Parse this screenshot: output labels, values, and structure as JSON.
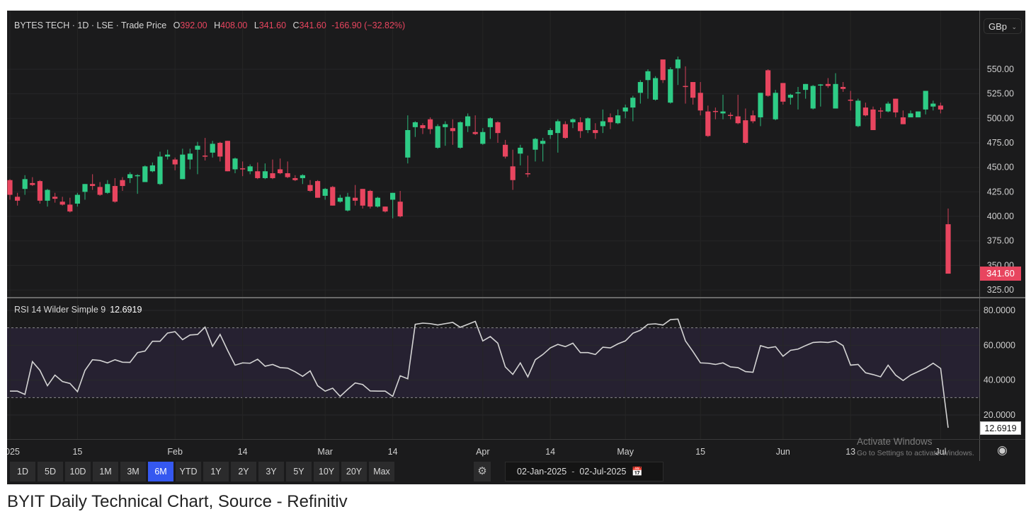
{
  "header": {
    "symbol": "BYTES TECH",
    "interval": "1D",
    "exchange": "LSE",
    "price_type": "Trade Price",
    "open_label": "O",
    "open": "392.00",
    "high_label": "H",
    "high": "408.00",
    "low_label": "L",
    "low": "341.60",
    "close_label": "C",
    "close": "341.60",
    "change": "-166.90",
    "change_pct": "(−32.82%)"
  },
  "currency": "GBp",
  "last_price_label": "341.60",
  "rsi": {
    "label": "RSI 14 Wilder Simple 9",
    "value": "12.6919"
  },
  "toolbar": {
    "ranges": [
      "1D",
      "5D",
      "10D",
      "1M",
      "3M",
      "6M",
      "YTD",
      "1Y",
      "2Y",
      "3Y",
      "5Y",
      "10Y",
      "20Y",
      "Max"
    ],
    "active": "6M",
    "date_from": "02-Jan-2025",
    "date_to": "02-Jul-2025",
    "sep": "-"
  },
  "watermark": {
    "line1": "Activate Windows",
    "line2": "Go to Settings to activate Windows."
  },
  "caption": "BYIT Daily Technical Chart, Source - Refinitiv",
  "colors": {
    "up": "#2ecc86",
    "down": "#e8455f",
    "background": "#1b1b1c",
    "rsi_line": "#d4d4d4",
    "rsi_band": "#262131"
  },
  "chart_data": [
    {
      "type": "candlestick",
      "title": "BYTES TECH · 1D · LSE · Trade Price",
      "ylabel": "GBp",
      "ylim": [
        318,
        570
      ],
      "yticks": [
        "550.00",
        "525.00",
        "500.00",
        "475.00",
        "450.00",
        "425.00",
        "400.00",
        "375.00",
        "350.00",
        "325.00"
      ],
      "ytick_values": [
        550,
        525,
        500,
        475,
        450,
        425,
        400,
        375,
        350,
        325
      ],
      "xticks": [
        {
          "label": "2025",
          "index": 0
        },
        {
          "label": "15",
          "index": 9
        },
        {
          "label": "Feb",
          "index": 22
        },
        {
          "label": "14",
          "index": 31
        },
        {
          "label": "Mar",
          "index": 42
        },
        {
          "label": "14",
          "index": 51
        },
        {
          "label": "Apr",
          "index": 63
        },
        {
          "label": "14",
          "index": 72
        },
        {
          "label": "May",
          "index": 82
        },
        {
          "label": "15",
          "index": 92
        },
        {
          "label": "Jun",
          "index": 103
        },
        {
          "label": "13",
          "index": 112
        },
        {
          "label": "Jul",
          "index": 124
        }
      ],
      "ohlc": [
        [
          437,
          438,
          417,
          422
        ],
        [
          420,
          424,
          411,
          416
        ],
        [
          428,
          442,
          422,
          438
        ],
        [
          434,
          440,
          431,
          432
        ],
        [
          436,
          437,
          413,
          416
        ],
        [
          416,
          428,
          410,
          427
        ],
        [
          420,
          424,
          414,
          418
        ],
        [
          415,
          420,
          411,
          412
        ],
        [
          412,
          419,
          404,
          405
        ],
        [
          413,
          424,
          410,
          422
        ],
        [
          425,
          433,
          417,
          433
        ],
        [
          433,
          443,
          427,
          431
        ],
        [
          430,
          435,
          421,
          422
        ],
        [
          424,
          437,
          423,
          433
        ],
        [
          431,
          439,
          414,
          415
        ],
        [
          437,
          440,
          426,
          431
        ],
        [
          439,
          445,
          434,
          443
        ],
        [
          442,
          443,
          423,
          442
        ],
        [
          435,
          452,
          435,
          451
        ],
        [
          446,
          455,
          445,
          452
        ],
        [
          433,
          466,
          432,
          461
        ],
        [
          461,
          468,
          458,
          463
        ],
        [
          458,
          460,
          447,
          453
        ],
        [
          438,
          469,
          438,
          463
        ],
        [
          458,
          469,
          448,
          464
        ],
        [
          468,
          476,
          443,
          472
        ],
        [
          462,
          480,
          457,
          461
        ],
        [
          465,
          477,
          460,
          474
        ],
        [
          475,
          476,
          456,
          461
        ],
        [
          477,
          477,
          446,
          446
        ],
        [
          448,
          460,
          444,
          459
        ],
        [
          449,
          456,
          441,
          448
        ],
        [
          446,
          453,
          443,
          451
        ],
        [
          446,
          455,
          438,
          439
        ],
        [
          439,
          454,
          438,
          446
        ],
        [
          444,
          458,
          438,
          439
        ],
        [
          448,
          459,
          443,
          444
        ],
        [
          444,
          456,
          439,
          440
        ],
        [
          439,
          442,
          436,
          437
        ],
        [
          439,
          443,
          433,
          442
        ],
        [
          432,
          437,
          425,
          426
        ],
        [
          436,
          437,
          419,
          419
        ],
        [
          421,
          429,
          417,
          428
        ],
        [
          430,
          431,
          411,
          411
        ],
        [
          415,
          422,
          414,
          419
        ],
        [
          406,
          424,
          405,
          420
        ],
        [
          419,
          432,
          411,
          416
        ],
        [
          428,
          428,
          408,
          411
        ],
        [
          426,
          427,
          408,
          410
        ],
        [
          410,
          420,
          409,
          419
        ],
        [
          410,
          410,
          404,
          405
        ],
        [
          417,
          424,
          398,
          424
        ],
        [
          415,
          426,
          399,
          400
        ],
        [
          460,
          503,
          454,
          488
        ],
        [
          491,
          497,
          481,
          496
        ],
        [
          493,
          495,
          484,
          490
        ],
        [
          499,
          501,
          484,
          489
        ],
        [
          470,
          494,
          469,
          492
        ],
        [
          491,
          497,
          472,
          494
        ],
        [
          490,
          499,
          473,
          487
        ],
        [
          470,
          497,
          469,
          496
        ],
        [
          492,
          505,
          486,
          502
        ],
        [
          486,
          503,
          483,
          484
        ],
        [
          474,
          490,
          473,
          486
        ],
        [
          491,
          501,
          479,
          500
        ],
        [
          496,
          497,
          475,
          485
        ],
        [
          473,
          478,
          459,
          461
        ],
        [
          451,
          468,
          427,
          437
        ],
        [
          464,
          473,
          452,
          470
        ],
        [
          444,
          462,
          440,
          443.5
        ],
        [
          468,
          480,
          456,
          479
        ],
        [
          474,
          480,
          456,
          477
        ],
        [
          483,
          490,
          479,
          488
        ],
        [
          485,
          499,
          465,
          497
        ],
        [
          494,
          497,
          479,
          480
        ],
        [
          496,
          500,
          490,
          499
        ],
        [
          496,
          501,
          480,
          487
        ],
        [
          488,
          501,
          485,
          500
        ],
        [
          488,
          495,
          479,
          485
        ],
        [
          492,
          509,
          485,
          497
        ],
        [
          501,
          505,
          489,
          496
        ],
        [
          495,
          509,
          494,
          503
        ],
        [
          507,
          514,
          500,
          511
        ],
        [
          511,
          523,
          497,
          521
        ],
        [
          526,
          539,
          515,
          537
        ],
        [
          539,
          550,
          520,
          548
        ],
        [
          519,
          543,
          518,
          541
        ],
        [
          560,
          560,
          536,
          539
        ],
        [
          516,
          552,
          515,
          550
        ],
        [
          551,
          563,
          534,
          560
        ],
        [
          533,
          553,
          515,
          532
        ],
        [
          537,
          537,
          514,
          521
        ],
        [
          526,
          537,
          503,
          508
        ],
        [
          507,
          513,
          481,
          482
        ],
        [
          507.5,
          511,
          499,
          507
        ],
        [
          505,
          524,
          499,
          507
        ],
        [
          503.5,
          506,
          499,
          503
        ],
        [
          502,
          524,
          494,
          495
        ],
        [
          498,
          510,
          474,
          475
        ],
        [
          503,
          508,
          495,
          497
        ],
        [
          501,
          526,
          492,
          526
        ],
        [
          549,
          550,
          522,
          523
        ],
        [
          499,
          529,
          498,
          526
        ],
        [
          536,
          536,
          514,
          517
        ],
        [
          521,
          525,
          514,
          524
        ],
        [
          526,
          532,
          509,
          526.5
        ],
        [
          529,
          535,
          520,
          535
        ],
        [
          510,
          534,
          509,
          533
        ],
        [
          534,
          535,
          512,
          534.5
        ],
        [
          535,
          541,
          531,
          533
        ],
        [
          510,
          546,
          510,
          535
        ],
        [
          532,
          537,
          527,
          530
        ],
        [
          519,
          528,
          508,
          518
        ],
        [
          492,
          520,
          491,
          518
        ],
        [
          511,
          516,
          502,
          503
        ],
        [
          509,
          512,
          488,
          488
        ],
        [
          508,
          511,
          500,
          507
        ],
        [
          507,
          517,
          506,
          515
        ],
        [
          520,
          520,
          501,
          506
        ],
        [
          501,
          508,
          494,
          494
        ],
        [
          501,
          508,
          501,
          505
        ],
        [
          501,
          507,
          501,
          507
        ],
        [
          509,
          528,
          504,
          528
        ],
        [
          512,
          518,
          508,
          515
        ],
        [
          513,
          516,
          505,
          509
        ],
        [
          392,
          408,
          341.6,
          341.6
        ]
      ]
    },
    {
      "type": "line",
      "title": "RSI 14 Wilder Simple 9",
      "ylim": [
        7,
        86
      ],
      "overbought": 70,
      "oversold": 30,
      "yticks": [
        "80.0000",
        "60.0000",
        "40.0000",
        "20.0000"
      ],
      "ytick_values": [
        80,
        60,
        40,
        20
      ],
      "values": [
        33.7,
        33.7,
        31.8,
        50.6,
        45.6,
        36.8,
        42.9,
        39.2,
        38.1,
        33.4,
        45.6,
        51.7,
        51.3,
        49.9,
        51.7,
        50.3,
        50.2,
        55.8,
        56.7,
        62.3,
        62.3,
        67.0,
        67.8,
        63.2,
        65.9,
        66.2,
        70.4,
        59.4,
        66.2,
        57.1,
        48.6,
        49.9,
        49.7,
        52.0,
        48.0,
        49.0,
        47.2,
        46.9,
        44.8,
        42.2,
        45.3,
        36.8,
        33.7,
        35.4,
        30.7,
        34.7,
        38.4,
        37.5,
        33.8,
        33.7,
        33.7,
        30.7,
        42.5,
        40.8,
        72.0,
        72.7,
        72.4,
        71.6,
        72.4,
        73.1,
        70.3,
        72.0,
        73.7,
        62.5,
        65.0,
        61.2,
        47.6,
        43.3,
        49.9,
        41.9,
        51.7,
        54.7,
        58.5,
        60.5,
        59.2,
        61.2,
        55.8,
        55.8,
        54.7,
        58.9,
        58.5,
        60.8,
        62.5,
        66.9,
        68.6,
        72.0,
        72.3,
        71.6,
        74.7,
        75.0,
        62.5,
        56.4,
        49.9,
        49.7,
        49.0,
        49.9,
        47.6,
        47.2,
        44.9,
        44.5,
        59.8,
        58.5,
        59.2,
        53.7,
        57.1,
        57.8,
        59.8,
        61.6,
        61.9,
        61.6,
        62.5,
        59.8,
        48.6,
        49.0,
        44.2,
        43.2,
        41.9,
        48.6,
        42.9,
        39.8,
        42.9,
        44.9,
        46.9,
        49.7,
        46.7,
        12.6919
      ]
    }
  ]
}
